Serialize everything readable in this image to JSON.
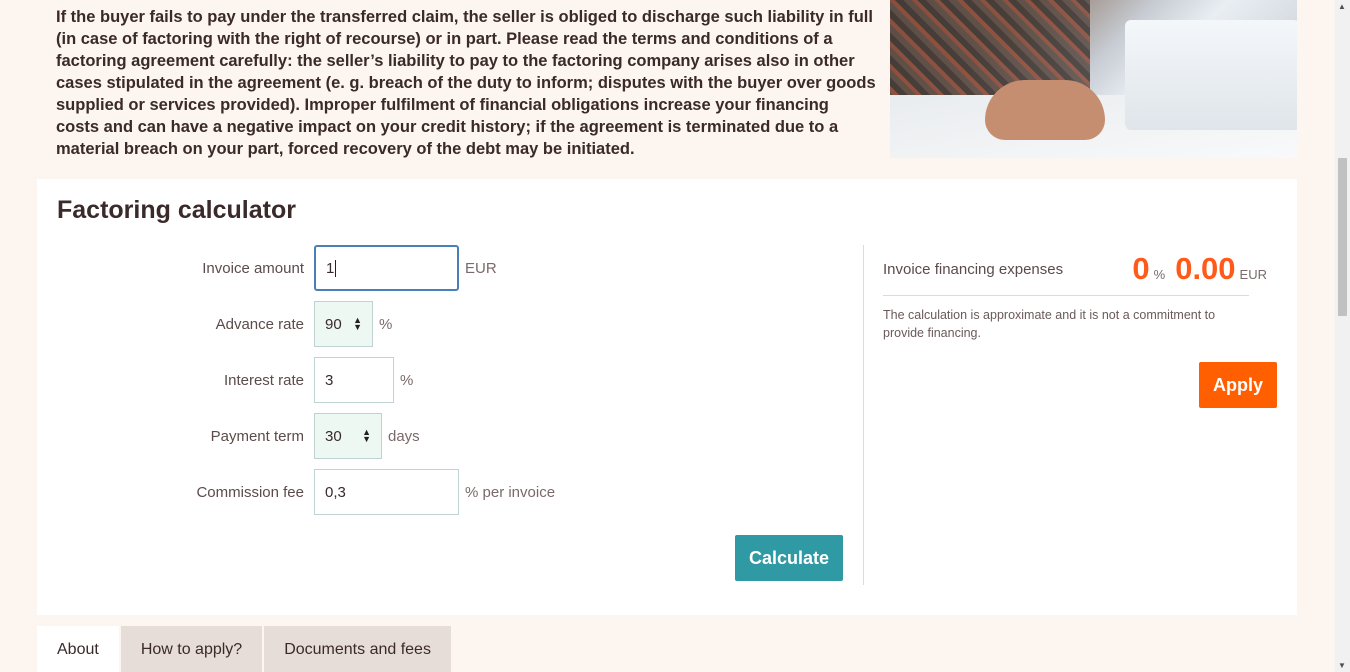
{
  "intro": {
    "text": "If the buyer fails to pay under the transferred claim, the seller is obliged to discharge such liability in full (in case of factoring with the right of recourse) or in part. Please read the terms and conditions of a factoring agreement carefully: the seller’s liability to pay to the factoring company arises also in other cases stipulated in the agreement (e. g. breach of the duty to inform; disputes with the buyer over goods supplied or services provided). Improper fulfilment of financial obligations increase your financing costs and can have a negative impact on your credit history; if the agreement is terminated due to a material breach on your part, forced recovery of the debt may be initiated."
  },
  "calculator": {
    "title": "Factoring calculator",
    "fields": {
      "invoice_amount": {
        "label": "Invoice amount",
        "value": "1",
        "unit": "EUR"
      },
      "advance_rate": {
        "label": "Advance rate",
        "value": "90",
        "unit": "%"
      },
      "interest_rate": {
        "label": "Interest rate",
        "value": "3",
        "unit": "%"
      },
      "payment_term": {
        "label": "Payment term",
        "value": "30",
        "unit": "days"
      },
      "commission_fee": {
        "label": "Commission fee",
        "value": "0,3",
        "unit": "% per invoice"
      }
    },
    "calculate_label": "Calculate",
    "result": {
      "label": "Invoice financing expenses",
      "percent": "0",
      "percent_unit": "%",
      "amount": "0.00",
      "currency": "EUR",
      "note": "The calculation is approximate and it is not a commitment to provide financing."
    },
    "apply_label": "Apply"
  },
  "tabs": [
    {
      "label": "About",
      "active": true
    },
    {
      "label": "How to apply?",
      "active": false
    },
    {
      "label": "Documents and fees",
      "active": false
    }
  ],
  "colors": {
    "accent_orange": "#ff5f00",
    "accent_teal": "#2f9aa3",
    "background": "#fdf5ef"
  }
}
